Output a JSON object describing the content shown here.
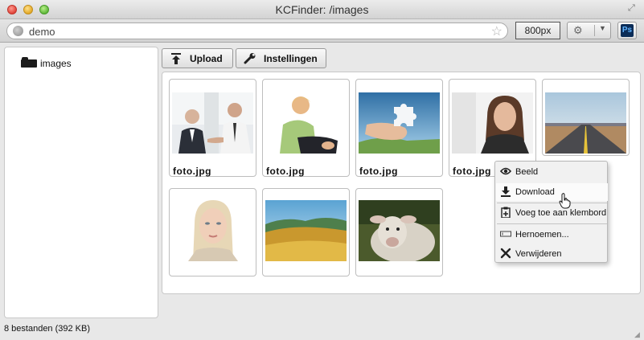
{
  "window": {
    "title": "KCFinder: /images"
  },
  "toolbar": {
    "address": "demo",
    "size_label": "800px",
    "ps_label": "Ps"
  },
  "sidebar": {
    "folders": [
      {
        "label": "images"
      }
    ]
  },
  "actions": {
    "upload_label": "Upload",
    "settings_label": "Instellingen"
  },
  "files": [
    {
      "name": "foto.jpg",
      "thumb": "business-men"
    },
    {
      "name": "foto.jpg",
      "thumb": "woman-sitting"
    },
    {
      "name": "foto.jpg",
      "thumb": "puzzle-hand"
    },
    {
      "name": "foto.jpg",
      "thumb": "businesswoman"
    },
    {
      "name": "",
      "thumb": "road"
    },
    {
      "name": "",
      "thumb": "blonde-woman"
    },
    {
      "name": "",
      "thumb": "hills"
    },
    {
      "name": "",
      "thumb": "sheep"
    }
  ],
  "context_menu": {
    "items": [
      {
        "label": "Beeld",
        "icon": "eye-icon"
      },
      {
        "label": "Download",
        "icon": "download-icon"
      },
      {
        "label": "Voeg toe aan klembord",
        "icon": "clipboard-add-icon"
      },
      {
        "label": "Hernoemen...",
        "icon": "rename-icon"
      },
      {
        "label": "Verwijderen",
        "icon": "delete-icon"
      }
    ]
  },
  "status": {
    "text": "8 bestanden (392 KB)"
  },
  "colors": {
    "panel_bg": "#ffffff",
    "window_bg": "#e8e8e8",
    "menu_bg": "#f1f1f1"
  }
}
